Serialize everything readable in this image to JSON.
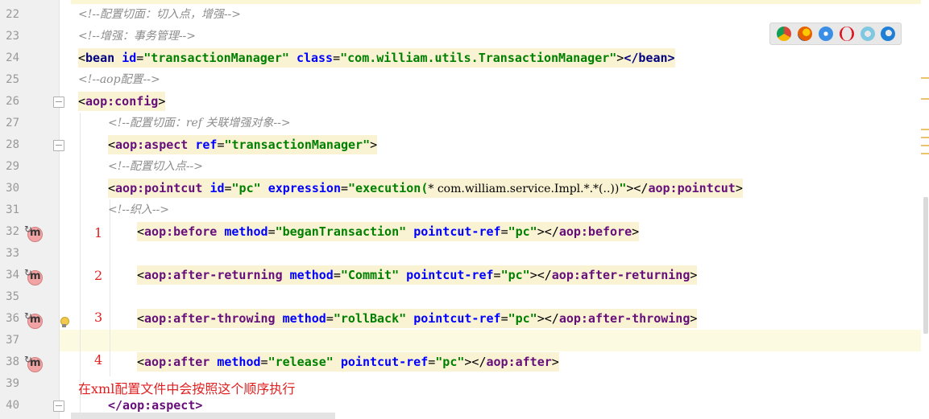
{
  "editor": {
    "line_numbers": [
      "22",
      "23",
      "24",
      "25",
      "26",
      "27",
      "28",
      "29",
      "30",
      "31",
      "32",
      "33",
      "34",
      "35",
      "36",
      "37",
      "38",
      "39",
      "40"
    ],
    "lines": {
      "l22": "<!--配置切面：切入点，增强-->",
      "l23": "<!--增强：事务管理-->",
      "l25": "<!--aop配置-->",
      "l27": "<!--配置切面：ref 关联增强对象-->",
      "l29": "<!--配置切入点-->",
      "l31": "<!--织入-->"
    },
    "bean": {
      "tag": "bean",
      "id_attr": "id",
      "id_value": "\"transactionManager\"",
      "class_attr": "class",
      "class_value": "\"com.william.utils.TransactionManager\"",
      "close": "</bean>"
    },
    "aop_config": {
      "open": "aop:config"
    },
    "aspect": {
      "tag": "aop:aspect",
      "ref_attr": "ref",
      "ref_value": "\"transactionManager\"",
      "close": "</aop:aspect>"
    },
    "pointcut": {
      "tag": "aop:pointcut",
      "id_attr": "id",
      "id_value": "\"pc\"",
      "expr_attr": "expression",
      "expr_q1": "\"execution(",
      "expr_body": "* com.william.service.Impl.*.*(..))",
      "expr_q2": "\"",
      "close_tag": "aop:pointcut"
    },
    "advices": [
      {
        "num": "1",
        "tag": "aop:before",
        "method_value": "\"beganTransaction\"",
        "ref_value": "\"pc\"",
        "close_tag": "aop:before"
      },
      {
        "num": "2",
        "tag": "aop:after-returning",
        "method_value": "\"Commit\"",
        "ref_value": "\"pc\"",
        "close_tag": "aop:after-returning"
      },
      {
        "num": "3",
        "tag": "aop:after-throwing",
        "method_value": "\"rollBack\"",
        "ref_value": "\"pc\"",
        "close_tag": "aop:after-throwing"
      },
      {
        "num": "4",
        "tag": "aop:after",
        "method_value": "\"release\"",
        "ref_value": "\"pc\"",
        "close_tag": "aop:after"
      }
    ],
    "attr_method": "method",
    "attr_pointcut_ref": "pointcut-ref",
    "gutter_icon_letter": "m"
  },
  "annotation_note": "在xml配置文件中会按照这个顺序执行",
  "browser_icons": [
    "chrome-icon",
    "firefox-icon",
    "safari-icon",
    "opera-icon",
    "ie-icon",
    "edge-icon"
  ],
  "colors": {
    "tag": "#000080",
    "attr": "#0000ff",
    "value": "#008000",
    "comment": "#8c8c8c",
    "note": "#e02020",
    "highlight": "#faf3d3"
  }
}
